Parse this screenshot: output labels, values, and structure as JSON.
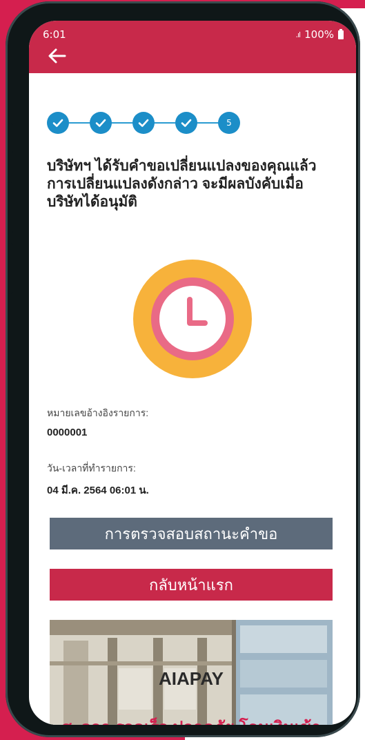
{
  "status_bar": {
    "time": "6:01",
    "battery": "100%"
  },
  "header": {
    "back_icon": "arrow-left-icon"
  },
  "stepper": {
    "steps": [
      {
        "state": "done",
        "icon": "check-icon"
      },
      {
        "state": "done",
        "icon": "check-icon"
      },
      {
        "state": "done",
        "icon": "check-icon"
      },
      {
        "state": "done",
        "icon": "check-icon"
      },
      {
        "state": "current",
        "label": "5"
      }
    ]
  },
  "main": {
    "headline": "บริษัทฯ ได้รับคำขอเปลี่ยนแปลงของคุณแล้ว การเปลี่ยนแปลงดังกล่าว จะมีผลบังคับเมื่อบริษัทได้อนุมัติ",
    "status_icon": "clock-icon",
    "reference_label": "หมายเลขอ้างอิงรายการ:",
    "reference_value": "0000001",
    "datetime_label": "วัน-เวลาที่ทำรายการ:",
    "datetime_value": "04 มี.ค. 2564 06:01 น."
  },
  "actions": {
    "check_status_label": "การตรวจสอบสถานะคำขอ",
    "home_label": "กลับหน้าแรก"
  },
  "banner": {
    "title": "AIAPAY",
    "subtitle": "สะดวก รวดเร็ว ปลอดภัย โอนเงินเข้า"
  },
  "colors": {
    "brand_red": "#c8294a",
    "step_blue": "#1c8ec8",
    "button_gray": "#5d6b7b",
    "clock_orange": "#f7b23b",
    "clock_pink": "#e96a86"
  }
}
